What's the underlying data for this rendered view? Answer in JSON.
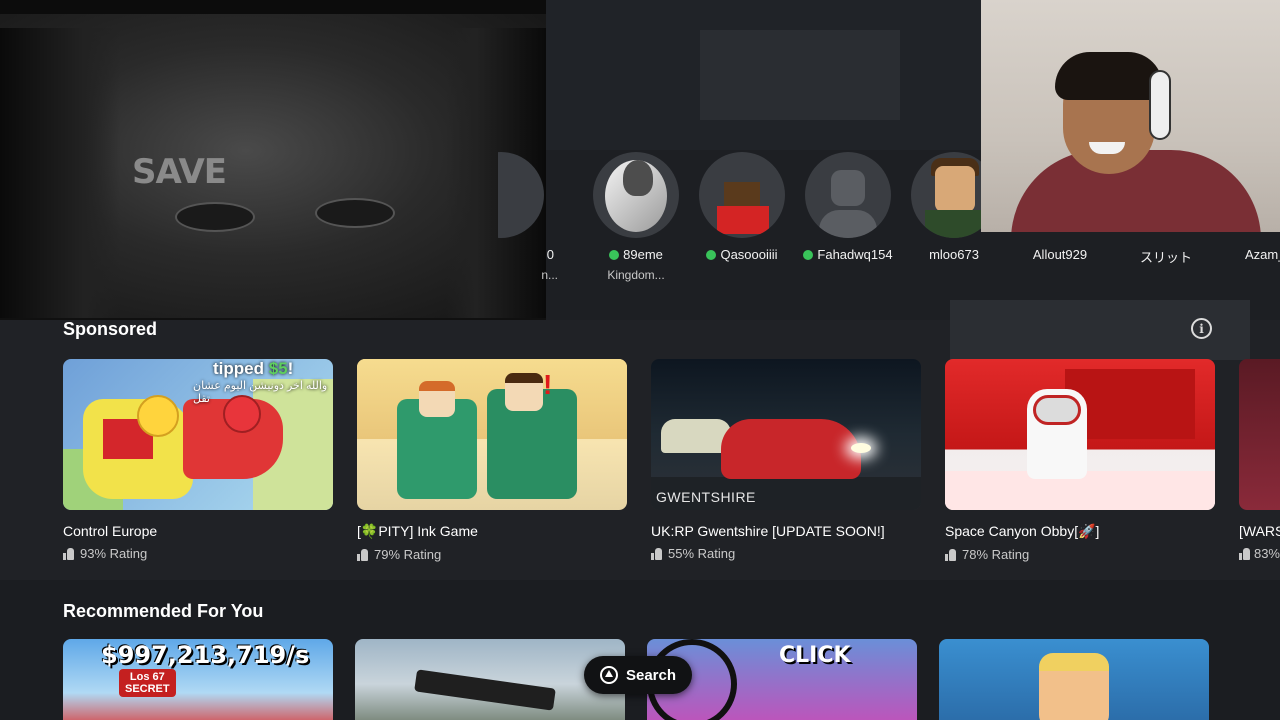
{
  "video_overlay": {
    "text": "SAVE"
  },
  "friends": [
    {
      "name": "0",
      "sub": "n...",
      "online": false
    },
    {
      "name": "89eme",
      "sub": "Kingdom...",
      "online": true
    },
    {
      "name": "Qasoooiiii",
      "sub": "",
      "online": true
    },
    {
      "name": "Fahadwq154",
      "sub": "",
      "online": true
    },
    {
      "name": "mloo673",
      "sub": "",
      "online": false
    },
    {
      "name": "Allout929",
      "sub": "",
      "online": false
    },
    {
      "name": "スリット",
      "sub": "",
      "online": false
    },
    {
      "name": "Azam_",
      "sub": "",
      "online": false
    }
  ],
  "sponsored": {
    "title": "Sponsored",
    "info_icon": "info-icon",
    "games": [
      {
        "title": "Control Europe",
        "rating": "93% Rating",
        "banner": "tipped",
        "banner_amount": "$5",
        "banner_suffix": "!",
        "overlay_text": "والله اخر دونيشن اليوم عشان تقل"
      },
      {
        "title": "[🍀PITY] Ink Game",
        "rating": "79% Rating"
      },
      {
        "title": "UK:RP Gwentshire [UPDATE SOON!]",
        "rating": "55% Rating",
        "thumb_label": "GWENTSHIRE"
      },
      {
        "title": "Space Canyon Obby[🚀]",
        "rating": "78% Rating"
      },
      {
        "title": "[WARS",
        "rating": "83%"
      }
    ]
  },
  "recommended": {
    "title": "Recommended For You",
    "tiles": [
      {
        "cash_text": "$997,213,719/s",
        "badge_line1": "Los 67",
        "badge_line2": "SECRET"
      },
      {},
      {
        "click_text": "CLICK"
      },
      {}
    ]
  },
  "search_button": {
    "label": "Search",
    "icon": "triangle-button-icon"
  },
  "colors": {
    "background": "#1d1f23",
    "online": "#39c35a"
  }
}
